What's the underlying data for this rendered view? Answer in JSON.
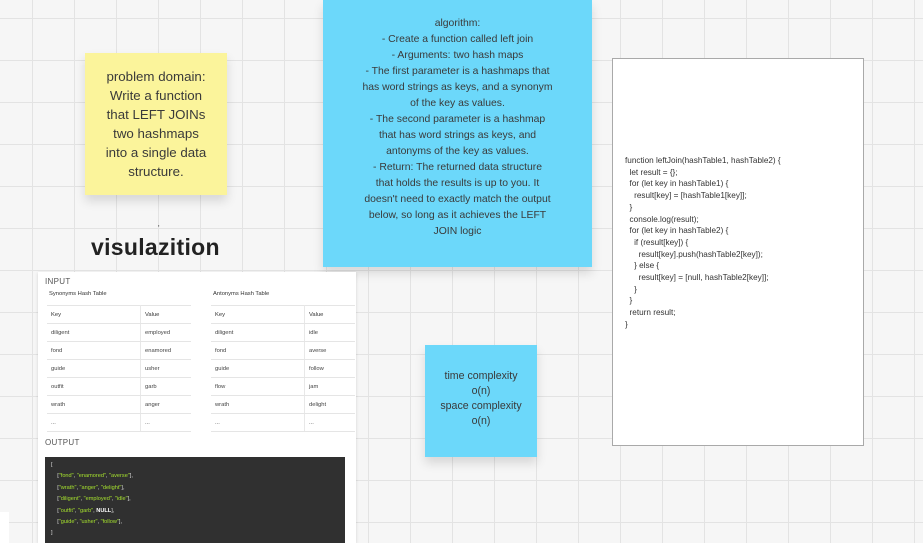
{
  "sticky_problem": {
    "lines": [
      "problem domain:",
      "Write a function",
      "that LEFT JOINs",
      "two hashmaps",
      "into a single data",
      "structure."
    ]
  },
  "sticky_algorithm": {
    "lines": [
      "algorithm:",
      "- Create a function called left join",
      "- Arguments: two hash maps",
      "- The first parameter is a hashmaps that",
      "has word strings as keys, and a synonym",
      "of the key as values.",
      "- The second parameter is a hashmap",
      "that has word strings as keys, and",
      "antonyms of the key as values.",
      "- Return: The returned data structure",
      "that holds the results is up to you. It",
      "doesn't need to exactly match the output",
      "below, so long as it achieves the LEFT",
      "JOIN logic"
    ]
  },
  "sticky_complexity": {
    "lines": [
      "time complexity",
      "o(n)",
      "space complexity",
      "o(n)"
    ]
  },
  "code": {
    "text": "function leftJoin(hashTable1, hashTable2) {\n  let result = {};\n  for (let key in hashTable1) {\n    result[key] = [hashTable1[key]];\n  }\n  console.log(result);\n  for (let key in hashTable2) {\n    if (result[key]) {\n      result[key].push(hashTable2[key]);\n    } else {\n      result[key] = [null, hashTable2[key]];\n    }\n  }\n  return result;\n}"
  },
  "heading": {
    "text": "visulazition",
    "tick": "'"
  },
  "viz": {
    "input_label": "INPUT",
    "output_label": "OUTPUT",
    "synonyms": {
      "title": "Synonyms Hash Table",
      "headers": [
        "Key",
        "Value"
      ],
      "rows": [
        [
          "diligent",
          "employed"
        ],
        [
          "fond",
          "enamored"
        ],
        [
          "guide",
          "usher"
        ],
        [
          "outfit",
          "garb"
        ],
        [
          "wrath",
          "anger"
        ],
        [
          "...",
          "..."
        ]
      ]
    },
    "antonyms": {
      "title": "Antonyms Hash Table",
      "headers": [
        "Key",
        "Value"
      ],
      "rows": [
        [
          "diligent",
          "idle"
        ],
        [
          "fond",
          "averse"
        ],
        [
          "guide",
          "follow"
        ],
        [
          "flow",
          "jam"
        ],
        [
          "wrath",
          "delight"
        ],
        [
          "...",
          "..."
        ]
      ]
    },
    "output": {
      "open": "[",
      "rows": [
        [
          "\"fond\"",
          "\"enamored\"",
          "\"averse\""
        ],
        [
          "\"wrath\"",
          "\"anger\"",
          "\"delight\""
        ],
        [
          "\"diligent\"",
          "\"employed\"",
          "\"idle\""
        ],
        [
          "\"outfit\"",
          "\"garb\"",
          "NULL"
        ],
        [
          "\"guide\"",
          "\"usher\"",
          "\"follow\""
        ]
      ],
      "close": "]"
    }
  },
  "colors": {
    "sticky_yellow": "#fbf49b",
    "sticky_blue": "#6cd8fa",
    "output_bg": "#303030",
    "output_string": "#a6e22e"
  }
}
